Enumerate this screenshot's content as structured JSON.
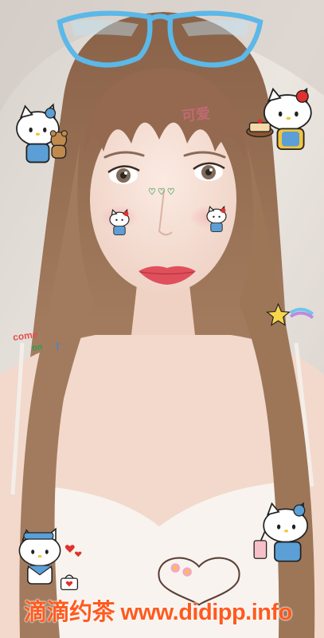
{
  "image": {
    "description_colors": {
      "background": "#e9e2dc",
      "hair": "#9c7356",
      "skin": "#f6e1d6",
      "lips": "#e0505c",
      "glasses": "#5bb8e8",
      "top": "#f8f3ee",
      "watermark": "#ff5a1f"
    },
    "stickers": [
      "glasses-icon",
      "kitty-with-bear-icon",
      "kitty-with-cake-icon",
      "kitty-cheek-left-icon",
      "kitty-cheek-right-icon",
      "star-icon",
      "kitty-sailor-icon",
      "kitty-drink-icon",
      "heart-outline-icon",
      "hearts-icon",
      "bag-icon"
    ]
  },
  "text": {
    "forehead": "可爱",
    "come_on_line1": "come",
    "come_on_line2": "on",
    "come_on_mark": "!",
    "cheek": "♡♡♡",
    "watermark": "滴滴约茶 www.didipp.info"
  }
}
